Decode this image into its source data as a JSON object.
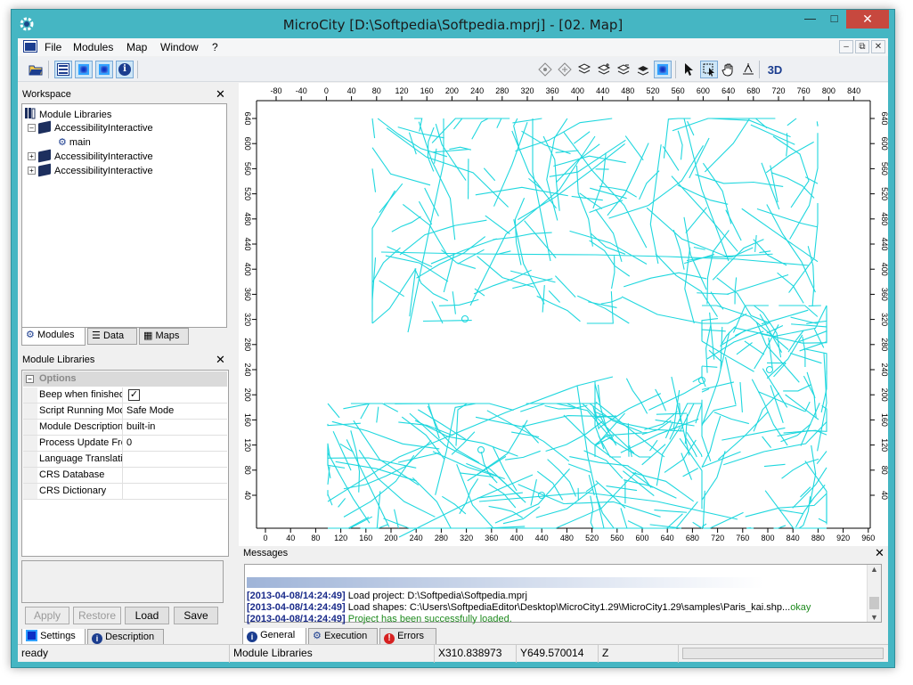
{
  "window": {
    "title": "MicroCity [D:\\Softpedia\\Softpedia.mprj] - [02. Map]"
  },
  "menu": [
    "File",
    "Modules",
    "Map",
    "Window",
    "?"
  ],
  "toolbar": {
    "icons": [
      "open-folder",
      "workspace-toggle",
      "map-toggle",
      "blue-square",
      "info",
      "layers",
      "node-select",
      "edit",
      "pan",
      "hand",
      "zoom",
      "select-arrow",
      "zoom-box",
      "hand-pan",
      "zoom-in",
      "3d"
    ],
    "three_d": "3D"
  },
  "workspace": {
    "title": "Workspace",
    "tree": [
      {
        "label": "Module Libraries",
        "level": 0
      },
      {
        "label": "AccessibilityInteractive",
        "level": 1,
        "expanded": true
      },
      {
        "label": "main",
        "level": 2
      },
      {
        "label": "AccessibilityInteractive",
        "level": 1,
        "expanded": false
      },
      {
        "label": "AccessibilityInteractive",
        "level": 1,
        "expanded": false
      }
    ],
    "tabs": [
      "Modules",
      "Data",
      "Maps"
    ]
  },
  "module_libraries": {
    "title": "Module Libraries",
    "group": "Options",
    "rows": [
      {
        "name": "Beep when finished",
        "value": "",
        "checkbox": true
      },
      {
        "name": "Script Running Mode",
        "value": "Safe Mode"
      },
      {
        "name": "Module Description",
        "value": "built-in"
      },
      {
        "name": "Process Update Frequency",
        "value": "0"
      },
      {
        "name": "Language Translations",
        "value": ""
      },
      {
        "name": "CRS Database",
        "value": ""
      },
      {
        "name": "CRS Dictionary",
        "value": ""
      }
    ],
    "buttons": {
      "apply": "Apply",
      "restore": "Restore",
      "load": "Load",
      "save": "Save"
    },
    "tabs": [
      "Settings",
      "Description"
    ]
  },
  "map": {
    "top_ticks": [
      "-80",
      "-40",
      "0",
      "40",
      "80",
      "120",
      "160",
      "200",
      "240",
      "280",
      "320",
      "360",
      "400",
      "440",
      "480",
      "520",
      "560",
      "600",
      "640",
      "680",
      "720",
      "760",
      "800",
      "840"
    ],
    "bottom_ticks": [
      "0",
      "40",
      "80",
      "120",
      "160",
      "200",
      "240",
      "280",
      "320",
      "360",
      "400",
      "440",
      "480",
      "520",
      "560",
      "600",
      "640",
      "680",
      "720",
      "760",
      "800",
      "840",
      "880",
      "920",
      "960"
    ],
    "side_ticks": [
      "640",
      "600",
      "560",
      "520",
      "480",
      "440",
      "400",
      "360",
      "320",
      "280",
      "240",
      "200",
      "160",
      "120",
      "80",
      "40"
    ],
    "line_color": "#1fd7de"
  },
  "messages": {
    "title": "Messages",
    "lines": [
      {
        "ts": "[2013-04-08/14:24:49]",
        "text": " Load project: D:\\Softpedia\\Softpedia.mprj",
        "suffix": ""
      },
      {
        "ts": "[2013-04-08/14:24:49]",
        "text": " Load shapes: C:\\Users\\SoftpediaEditor\\Desktop\\MicroCity1.29\\MicroCity1.29\\samples\\Paris_kai.shp...",
        "suffix": "okay"
      },
      {
        "ts": "[2013-04-08/14:24:49]",
        "text": "",
        "suffix": " Project has been successfully loaded."
      }
    ],
    "tabs": [
      "General",
      "Execution",
      "Errors"
    ]
  },
  "status": {
    "state": "ready",
    "context": "Module Libraries",
    "x": "X310.838973",
    "y": "Y649.570014",
    "z": "Z"
  }
}
